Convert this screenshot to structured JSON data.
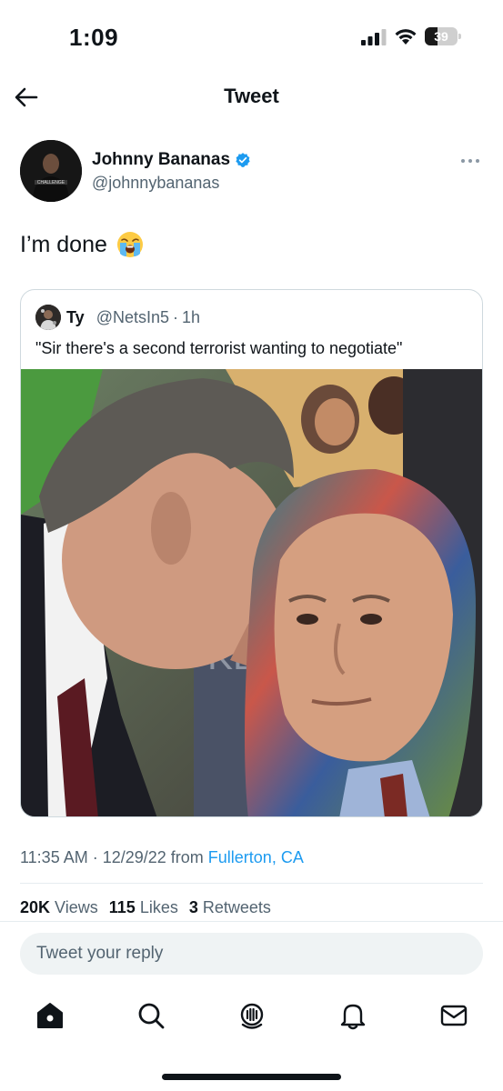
{
  "status_bar": {
    "time": "1:09",
    "battery_level": "39",
    "battery_fraction": 0.39
  },
  "nav": {
    "title": "Tweet",
    "back_icon": "arrow-left-icon"
  },
  "tweet": {
    "author_name": "Johnny Bananas",
    "author_handle": "@johnnybananas",
    "verified": true,
    "text": "I’m done",
    "emoji": "loudly-crying-face",
    "avatar_text": "CHALLENGE",
    "quoted": {
      "author_name": "Ty",
      "author_handle": "@NetsIn5",
      "separator": "·",
      "time": "1h",
      "text": "\"Sir there's a second terrorist wanting to negotiate\"",
      "media_letters": "KE M Co"
    },
    "timestamp": "11:35 AM · 12/29/22 from ",
    "location": "Fullerton, CA",
    "stats": {
      "views_count": "20K",
      "views_label": "Views",
      "likes_count": "115",
      "likes_label": "Likes",
      "retweets_count": "3",
      "retweets_label": "Retweets"
    }
  },
  "reply": {
    "placeholder": "Tweet your reply"
  },
  "tab_bar": [
    "home-icon",
    "search-icon",
    "spaces-icon",
    "notifications-icon",
    "messages-icon"
  ],
  "colors": {
    "accent": "#1d9bf0",
    "text": "#0f1419",
    "secondary": "#536471"
  }
}
